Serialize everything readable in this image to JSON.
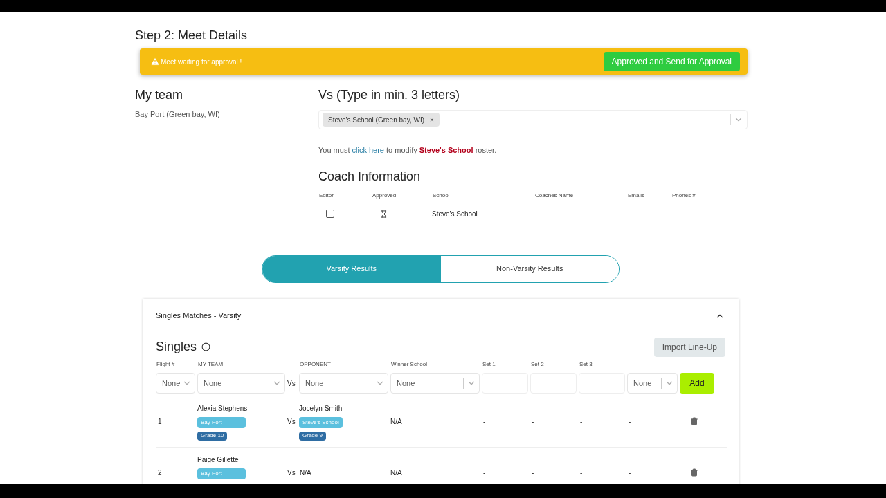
{
  "step_title": "Step 2: Meet Details",
  "alert": {
    "message": "Meet waiting for approval !",
    "button": "Approved and Send for Approval"
  },
  "my_team": {
    "heading": "My team",
    "value": "Bay Port (Green bay, WI)"
  },
  "opponent": {
    "heading": "Vs (Type in min. 3 letters)",
    "chips": [
      {
        "label": "Steve's School (Green bay, WI)",
        "remove": "×"
      }
    ]
  },
  "roster_note": {
    "before": "You must",
    "link": "click here",
    "middle": "to modify",
    "school": "Steve's School",
    "after": "roster."
  },
  "coach_info": {
    "heading": "Coach Information",
    "columns": [
      "Editor",
      "Approved",
      "School",
      "Coaches Name",
      "Emails",
      "Phones #"
    ],
    "rows": [
      {
        "editor_checked": false,
        "approved": false,
        "school": "Steve's School"
      }
    ]
  },
  "result_tabs": [
    {
      "label": "Varsity Results",
      "selected": true
    },
    {
      "label": "Non-Varsity Results",
      "selected": false
    }
  ],
  "section": {
    "title": "Singles Matches - Varsity",
    "expanded": true,
    "heading": "Singles",
    "import_button": "Import Line-Up",
    "columns": [
      "Flight #",
      "MY TEAM",
      "OPPONENT",
      "Winner School",
      "Set 1",
      "Set 2",
      "Set 3"
    ],
    "entry": {
      "flight": "None",
      "my_team": "None",
      "vs": "Vs",
      "opponent": "None",
      "winner": "None",
      "last": "None",
      "add": "Add"
    },
    "matches": [
      {
        "flight": "1",
        "player": "Alexia Stephens",
        "team": "Bay Port",
        "grade": "Grade 10",
        "vs": "Vs",
        "opponent": {
          "player": "Jocelyn Smith",
          "team": "Steve's School",
          "grade": "Grade 9"
        },
        "winner": "N/A",
        "sets": [
          "-",
          "-",
          "-",
          "-"
        ]
      },
      {
        "flight": "2",
        "player": "Paige Gillette",
        "team": "Bay Port",
        "vs": "Vs",
        "opponent_text": "N/A",
        "winner": "N/A",
        "sets": [
          "-",
          "-",
          "-",
          "-"
        ]
      }
    ]
  }
}
